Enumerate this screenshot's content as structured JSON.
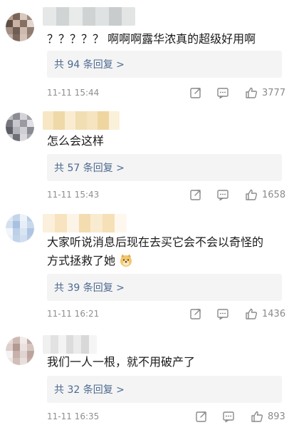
{
  "comments": [
    {
      "text": "？？？？？ 啊啊啊露华浓真的超级好用啊",
      "replies_label": "共 94 条回复 >",
      "timestamp": "11-11 15:44",
      "likes": "3777",
      "avatar_colors": [
        "#b49a8c",
        "#7a6558",
        "#d9c8bd",
        "#9e8a7f",
        "#5f4e46",
        "#c8b3a5",
        "#866f63",
        "#e2d6cf",
        "#a48f84",
        "#6f5c52",
        "#cdbbb0",
        "#907b70",
        "#bfaaa0",
        "#7d685d",
        "#d5c3b9",
        "#9a857a"
      ],
      "username_colors": [
        "#e6e8e8",
        "#d0d4d4",
        "#e9ebeb",
        "#cfd3d3",
        "#dfe2e2",
        "#c8cccc",
        "#e3e5e5"
      ]
    },
    {
      "text": "怎么会这样",
      "replies_label": "共 57 条回复 >",
      "timestamp": "11-11 15:43",
      "likes": "1658",
      "avatar_colors": [
        "#b9b9bf",
        "#8c8c94",
        "#d4d4d8",
        "#a2a2aa",
        "#76767e",
        "#c7c7cd",
        "#9a9aa2",
        "#e0e0e4",
        "#5e5e66",
        "#b3b3bb",
        "#cfcfd5",
        "#8a8a92",
        "#c1c1c7",
        "#6f6f77",
        "#d9d9de",
        "#a6a6ae"
      ],
      "username_colors": [
        "#f7e7c4",
        "#efd9a8",
        "#f9ecd1",
        "#f2deb3",
        "#f5e4bf",
        "#efd6a0",
        "#fbf0d9"
      ]
    },
    {
      "text": "大家听说消息后现在去买它会不会以奇怪的\n方式拯救了她",
      "replies_label": "共 39 条回复 >",
      "timestamp": "11-11 16:21",
      "likes": "1436",
      "avatar_colors": [
        "#dfe8f3",
        "#c4d5ea",
        "#eef3f9",
        "#b9cde6",
        "#d3e0ef",
        "#a9c1e0",
        "#e6eef7",
        "#c9d9ec",
        "#f2f6fb",
        "#bcd0e8",
        "#dae5f2",
        "#aec5e2",
        "#e9f0f8",
        "#c2d4ea",
        "#d0def0",
        "#b5cae6"
      ],
      "username_colors": [
        "#fbf0dc",
        "#f7e3bf",
        "#fcf4e6",
        "#f4dcb1",
        "#f9ebd0",
        "#f6e0b8",
        "#fdf7ee"
      ]
    },
    {
      "text": "我们一人一根，就不用破产了",
      "replies_label": "共 32 条回复 >",
      "timestamp": "11-11 16:35",
      "likes": "893",
      "avatar_colors": [
        "#e5dbd8",
        "#cdb9b3",
        "#f1ebe9",
        "#c0a8a1",
        "#ddd0cc",
        "#b39992",
        "#ebe2df",
        "#d4c3be",
        "#f6f2f1",
        "#c7b1aa",
        "#e0d4d0",
        "#bca49d",
        "#eee7e5",
        "#d0beb8",
        "#e8dfdc",
        "#c3aca5"
      ],
      "username_colors": [
        "#f0f0f0",
        "#e2e2e2",
        "#f3f3f3",
        "#dcdcdc",
        "#ebebeb",
        "#d8d8d8",
        "#f5f5f5"
      ]
    }
  ],
  "icons": {
    "share": "share-icon",
    "comment": "comment-icon",
    "like": "thumbs-up-icon",
    "emoji": "doge-emoji-icon"
  }
}
